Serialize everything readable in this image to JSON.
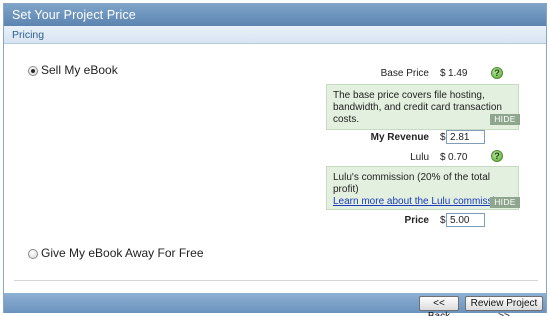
{
  "window": {
    "title": "Set Your Project Price"
  },
  "subheader": {
    "label": "Pricing"
  },
  "options": {
    "sell": {
      "label": "Sell My eBook",
      "selected": true
    },
    "free": {
      "label": "Give My eBook Away For Free",
      "selected": false
    }
  },
  "pricing": {
    "base_price": {
      "label": "Base Price",
      "currency": "$",
      "value": "1.49"
    },
    "base_info": {
      "text": "The base price covers file hosting, bandwidth, and credit card transaction costs.",
      "hide_label": "HIDE"
    },
    "revenue": {
      "label": "My Revenue",
      "currency": "$",
      "value": "2.81"
    },
    "lulu": {
      "label": "Lulu",
      "currency": "$",
      "value": "0.70"
    },
    "lulu_info": {
      "text": "Lulu's commission (20% of the total profit)",
      "link": "Learn more about the Lulu commission",
      "hide_label": "HIDE"
    },
    "price": {
      "label": "Price",
      "currency": "$",
      "value": "5.00"
    },
    "help_glyph": "?"
  },
  "footer": {
    "back_label": "<< Back",
    "review_label": "Review Project >>"
  },
  "colors": {
    "title_bar": "#5b84b0",
    "info_bg": "#e3f0df",
    "help_green": "#5ba83a"
  }
}
